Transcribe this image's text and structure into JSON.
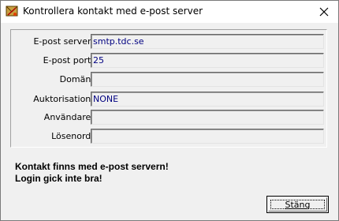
{
  "window": {
    "title": "Kontrollera kontakt med e-post server",
    "icon": "mail-app-icon",
    "close_icon": "close-icon"
  },
  "form": {
    "fields": [
      {
        "label": "E-post server:",
        "value": "smtp.tdc.se"
      },
      {
        "label": "E-post port:",
        "value": "25"
      },
      {
        "label": "Domän:",
        "value": ""
      },
      {
        "label": "Auktorisation:",
        "value": "NONE"
      },
      {
        "label": "Användare:",
        "value": ""
      },
      {
        "label": "Lösenord:",
        "value": ""
      }
    ]
  },
  "status": {
    "line1": "Kontakt finns med e-post servern!",
    "line2": "Login gick inte bra!"
  },
  "buttons": {
    "close_label": "Stäng"
  },
  "colors": {
    "field_text": "#000080",
    "background": "#f0f0f0"
  }
}
